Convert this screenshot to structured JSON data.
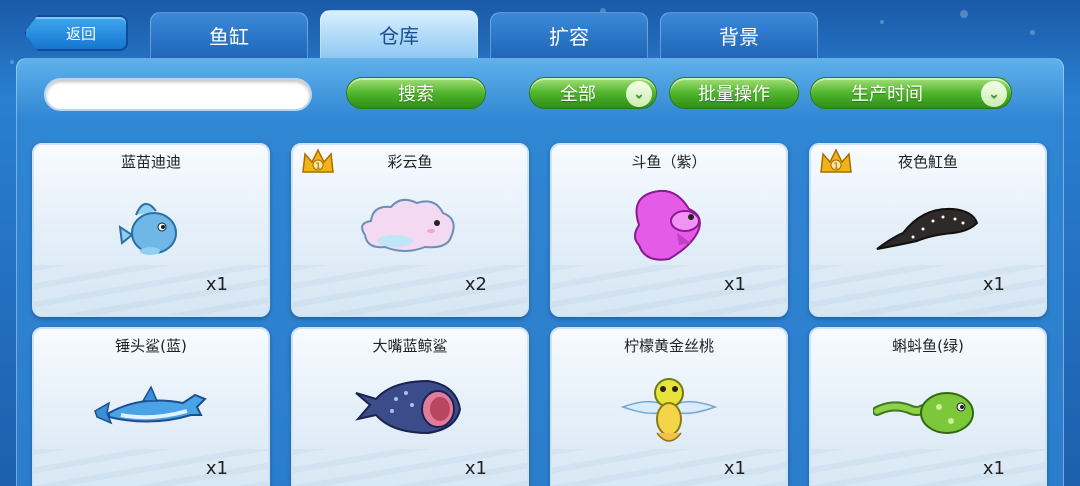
{
  "header": {
    "back_label": "返回",
    "tabs": [
      {
        "label": "鱼缸",
        "active": false
      },
      {
        "label": "仓库",
        "active": true
      },
      {
        "label": "扩容",
        "active": false
      },
      {
        "label": "背景",
        "active": false
      }
    ]
  },
  "toolbar": {
    "search_value": "",
    "search_button": "搜索",
    "filter_selected": "全部",
    "batch_button": "批量操作",
    "sort_selected": "生产时间"
  },
  "colors": {
    "accent_green": "#4fb52b",
    "panel_blue": "#2b7dcc",
    "crown_gold": "#f2b21c"
  },
  "items": [
    {
      "name": "蓝苗迪迪",
      "count": "x1",
      "crown": false,
      "crown_level": "",
      "icon": "blue-round-fish-icon"
    },
    {
      "name": "彩云鱼",
      "count": "x2",
      "crown": true,
      "crown_level": "1",
      "icon": "cloud-fish-icon"
    },
    {
      "name": "斗鱼（紫）",
      "count": "x1",
      "crown": false,
      "crown_level": "",
      "icon": "purple-betta-fish-icon"
    },
    {
      "name": "夜色魟鱼",
      "count": "x1",
      "crown": true,
      "crown_level": "1",
      "icon": "stingray-icon"
    },
    {
      "name": "锤头鲨(蓝)",
      "count": "x1",
      "crown": false,
      "crown_level": "",
      "icon": "hammerhead-shark-icon"
    },
    {
      "name": "大嘴蓝鲸鲨",
      "count": "x1",
      "crown": false,
      "crown_level": "",
      "icon": "whale-shark-icon"
    },
    {
      "name": "柠檬黄金丝桃",
      "count": "x1",
      "crown": false,
      "crown_level": "",
      "icon": "yellow-frog-fish-icon"
    },
    {
      "name": "蝌蚪鱼(绿)",
      "count": "x1",
      "crown": false,
      "crown_level": "",
      "icon": "green-tadpole-fish-icon"
    }
  ]
}
